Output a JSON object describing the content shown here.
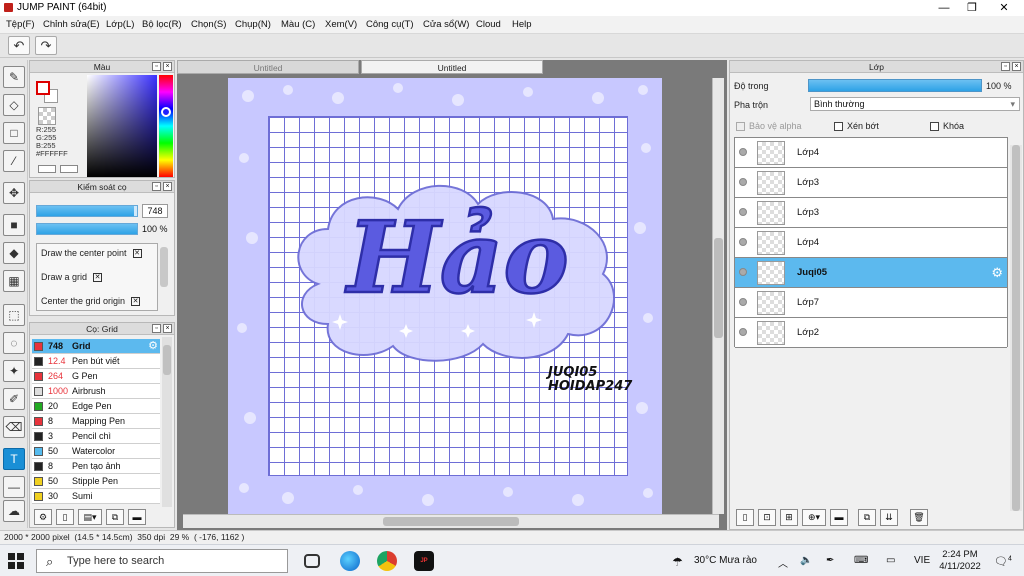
{
  "window": {
    "title": "JUMP PAINT (64bit)",
    "minimize": "—",
    "maximize": "❐",
    "close": "✕"
  },
  "menu": [
    "Tệp(F)",
    "Chỉnh sửa(E)",
    "Lớp(L)",
    "Bộ lọc(R)",
    "Chọn(S)",
    "Chụp(N)",
    "Màu (C)",
    "Xem(V)",
    "Công cụ(T)",
    "Cửa sổ(W)",
    "Cloud",
    "Help"
  ],
  "color_panel": {
    "title": "Màu",
    "r": "R:255",
    "g": "G:255",
    "b": "B:255",
    "hex": "#FFFFFF"
  },
  "brush_control": {
    "title": "Kiểm soát cọ",
    "size_value": "748",
    "size_fraction": 0.97,
    "opacity_value": "100 %",
    "opacity_fraction": 1.0,
    "options": [
      "Draw the center point",
      "Draw a grid",
      "Center the grid origin"
    ]
  },
  "brush_list": {
    "title": "Cọ: Grid",
    "items": [
      {
        "size": "748",
        "name": "Grid",
        "color": "#e8333b",
        "selected": true
      },
      {
        "size": "12.4",
        "name": "Pen bút viết",
        "color": "#222222",
        "size_color": "#e8333b"
      },
      {
        "size": "264",
        "name": "G Pen",
        "color": "#e8333b",
        "size_color": "#e8333b"
      },
      {
        "size": "1000",
        "name": "Airbrush",
        "color": "#dddddd",
        "size_color": "#e8333b"
      },
      {
        "size": "20",
        "name": "Edge Pen",
        "color": "#22aa22"
      },
      {
        "size": "8",
        "name": "Mapping Pen",
        "color": "#e8333b"
      },
      {
        "size": "3",
        "name": "Pencil chì",
        "color": "#222222"
      },
      {
        "size": "50",
        "name": "Watercolor",
        "color": "#55bbee"
      },
      {
        "size": "8",
        "name": "Pen tạo ảnh",
        "color": "#222222"
      },
      {
        "size": "50",
        "name": "Stipple Pen",
        "color": "#f0d020"
      },
      {
        "size": "30",
        "name": "Sumi",
        "color": "#f0d020"
      }
    ]
  },
  "canvas": {
    "tabs": [
      "Untitled",
      "Untitled"
    ],
    "art_title": "Hảo",
    "signature_line1": "JUQI05",
    "signature_line2": "HOIDAP247"
  },
  "layer_panel": {
    "title": "Lớp",
    "opacity_label": "Độ trong",
    "opacity_value": "100 %",
    "opacity_fraction": 1.0,
    "blend_label": "Pha trộn",
    "blend_value": "Bình thường",
    "protect_alpha": "Bảo vệ alpha",
    "clipping": "Xén bớt",
    "lock": "Khóa",
    "layers": [
      {
        "name": "Lớp4",
        "selected": false
      },
      {
        "name": "Lớp3",
        "selected": false
      },
      {
        "name": "Lớp3",
        "selected": false
      },
      {
        "name": "Lớp4",
        "selected": false
      },
      {
        "name": "Juqi05",
        "selected": true
      },
      {
        "name": "Lớp7",
        "selected": false
      },
      {
        "name": "Lớp2",
        "selected": false
      }
    ]
  },
  "status": {
    "text": "2000 * 2000 pixel  (14.5 * 14.5cm)  350 dpi  29 %  ( -176, 1162 )"
  },
  "taskbar": {
    "search_placeholder": "Type here to search",
    "weather": "30°C  Mưa rào",
    "lang": "VIE",
    "time": "2:24 PM",
    "date": "4/11/2022",
    "notifications": "4"
  },
  "colors": {
    "accent": "#2ea2e6",
    "selection": "#5cb9ee",
    "art_bg": "#c8c8ff",
    "lettering": "#5b5be0"
  }
}
